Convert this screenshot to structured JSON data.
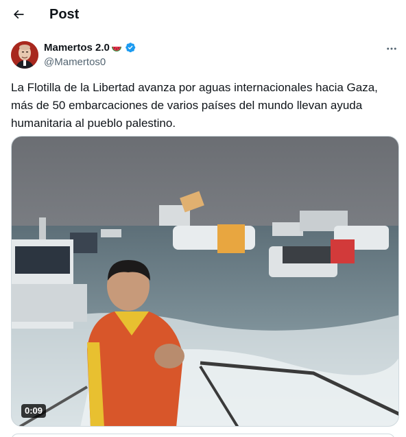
{
  "header": {
    "title": "Post",
    "back_icon": "arrow-left-icon"
  },
  "post": {
    "author": {
      "display_name": "Mamertos 2.0",
      "emoji": "watermelon-emoji",
      "verified": true,
      "handle": "@Mamertos0"
    },
    "text": "La Flotilla de la Libertad avanza por aguas internacionales hacia Gaza,\nmás de 50 embarcaciones de varios países del mundo llevan ayuda\nhumanitaria al pueblo palestino.",
    "media": {
      "type": "video",
      "duration": "0:09"
    }
  },
  "colors": {
    "text_primary": "#0f1419",
    "text_secondary": "#536471",
    "verified_blue": "#1d9bf0",
    "border": "#cfd9de"
  }
}
